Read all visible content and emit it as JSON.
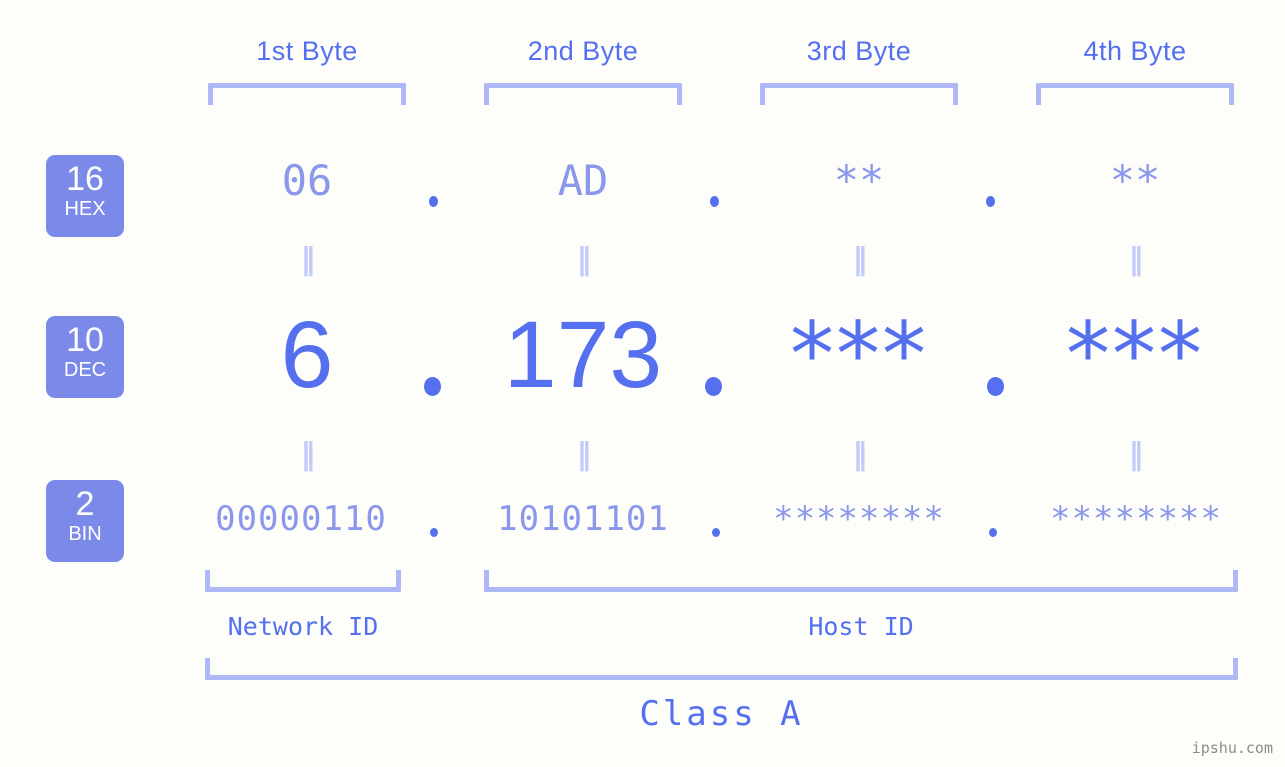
{
  "page": {
    "background_color": "#fdfdfa",
    "accent_strong": "#5570ef",
    "accent_light": "#8a97ec",
    "bracket_color": "#aeb8f7",
    "badge_color": "#7b8ae8",
    "watermark": "ipshu.com"
  },
  "byte_headers": [
    {
      "label": "1st Byte"
    },
    {
      "label": "2nd Byte"
    },
    {
      "label": "3rd Byte"
    },
    {
      "label": "4th Byte"
    }
  ],
  "bases": [
    {
      "number": "16",
      "name": "HEX"
    },
    {
      "number": "10",
      "name": "DEC"
    },
    {
      "number": "2",
      "name": "BIN"
    }
  ],
  "rows": {
    "hex": {
      "values": [
        "06",
        "AD",
        "**",
        "**"
      ],
      "separators": [
        ".",
        ".",
        "."
      ]
    },
    "dec": {
      "values": [
        "6",
        "173",
        "***",
        "***"
      ],
      "separators": [
        ".",
        ".",
        "."
      ]
    },
    "bin": {
      "values": [
        "00000110",
        "10101101",
        "********",
        "********"
      ],
      "separators": [
        ".",
        ".",
        "."
      ]
    }
  },
  "equal_signs": {
    "glyph": "‖",
    "count_per_gap": 4
  },
  "id_labels": [
    {
      "label": "Network ID"
    },
    {
      "label": "Host ID"
    }
  ],
  "class_label": {
    "label": "Class A"
  }
}
